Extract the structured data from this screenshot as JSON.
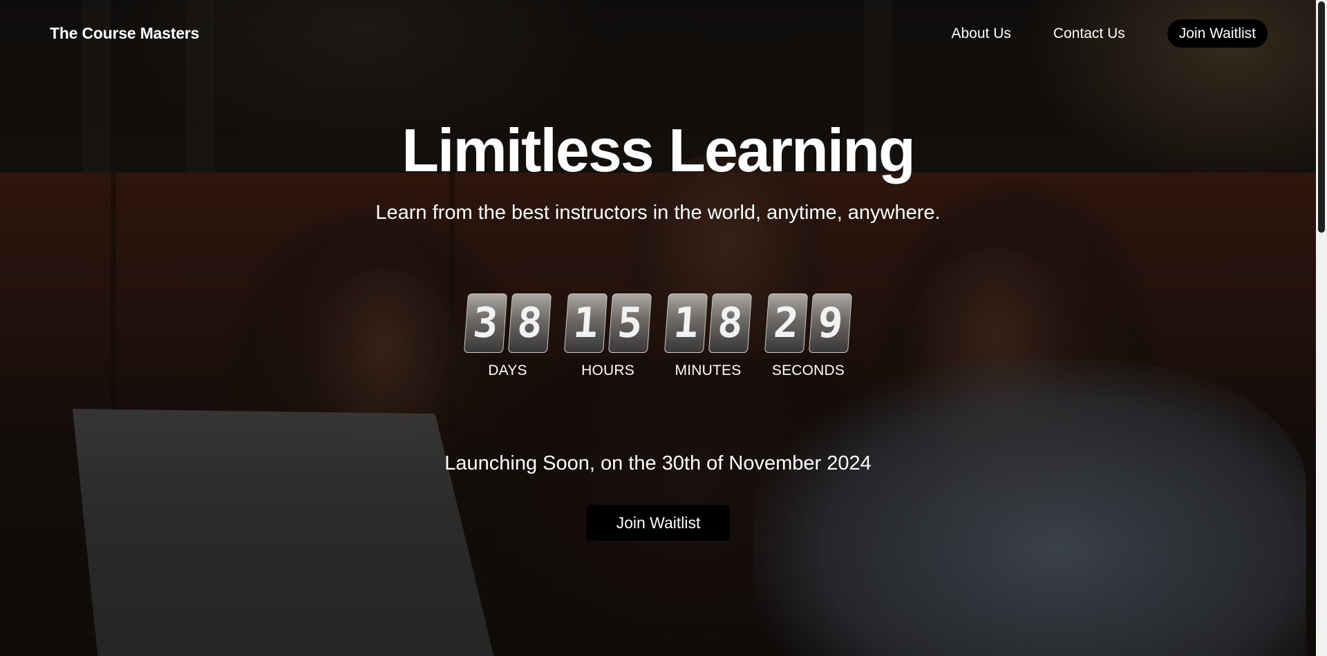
{
  "nav": {
    "brand": "The Course Masters",
    "links": [
      "About Us",
      "Contact Us"
    ],
    "cta_label": "Join Waitlist"
  },
  "hero": {
    "title": "Limitless Learning",
    "subtitle": "Learn from the best instructors in the world, anytime, anywhere.",
    "launch_text": "Launching Soon, on the 30th of November 2024",
    "cta_label": "Join Waitlist"
  },
  "countdown": {
    "days": {
      "digits": [
        "3",
        "8"
      ],
      "label": "DAYS"
    },
    "hours": {
      "digits": [
        "1",
        "5"
      ],
      "label": "HOURS"
    },
    "minutes": {
      "digits": [
        "1",
        "8"
      ],
      "label": "MINUTES"
    },
    "seconds": {
      "digits": [
        "2",
        "9"
      ],
      "label": "SECONDS"
    }
  },
  "colors": {
    "button_bg": "#000000",
    "text": "#ffffff",
    "overlay": "rgba(0,0,0,0.45)"
  },
  "icons": []
}
